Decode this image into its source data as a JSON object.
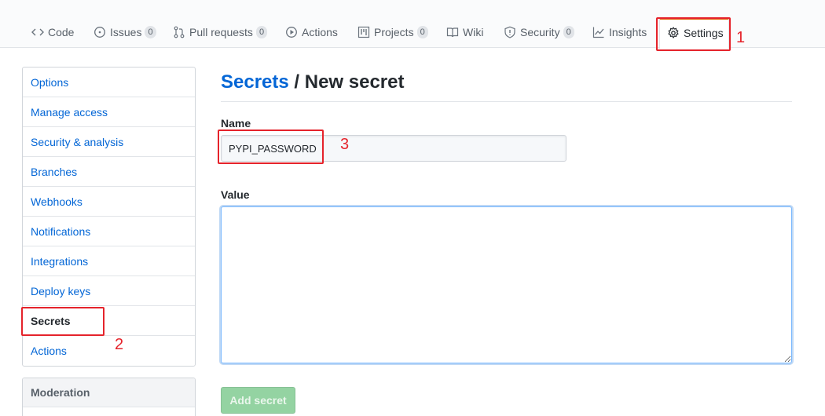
{
  "repo_nav": {
    "tabs": [
      {
        "label": "Code",
        "icon": "code-icon"
      },
      {
        "label": "Issues",
        "icon": "issue-icon",
        "count": "0"
      },
      {
        "label": "Pull requests",
        "icon": "pull-request-icon",
        "count": "0"
      },
      {
        "label": "Actions",
        "icon": "play-icon"
      },
      {
        "label": "Projects",
        "icon": "project-icon",
        "count": "0"
      },
      {
        "label": "Wiki",
        "icon": "book-icon"
      },
      {
        "label": "Security",
        "icon": "shield-icon",
        "count": "0"
      },
      {
        "label": "Insights",
        "icon": "graph-icon"
      },
      {
        "label": "Settings",
        "icon": "gear-icon",
        "selected": true
      }
    ]
  },
  "sidebar": {
    "items": [
      {
        "label": "Options"
      },
      {
        "label": "Manage access"
      },
      {
        "label": "Security & analysis"
      },
      {
        "label": "Branches"
      },
      {
        "label": "Webhooks"
      },
      {
        "label": "Notifications"
      },
      {
        "label": "Integrations"
      },
      {
        "label": "Deploy keys"
      },
      {
        "label": "Secrets",
        "selected": true
      },
      {
        "label": "Actions"
      }
    ],
    "moderation_heading": "Moderation"
  },
  "page": {
    "breadcrumb": "Secrets",
    "separator": " / ",
    "title": "New secret"
  },
  "form": {
    "name_label": "Name",
    "name_value": "PYPI_PASSWORD",
    "value_label": "Value",
    "value_text": "",
    "submit_label": "Add secret"
  },
  "annotations": {
    "step1": "1",
    "step2": "2",
    "step3": "3"
  },
  "colors": {
    "link": "#0366d6",
    "selected_tab_accent": "#e36209",
    "annotation_red": "#e5232b",
    "disabled_button": "#94d3a2"
  }
}
